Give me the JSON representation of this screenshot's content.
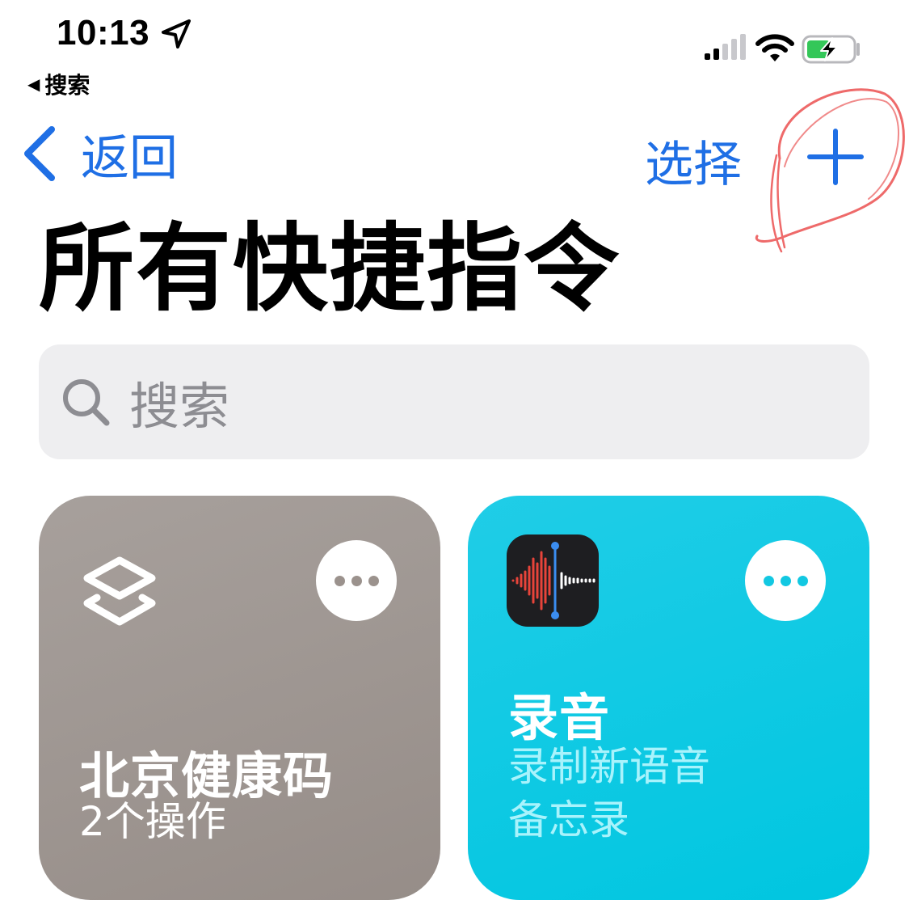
{
  "status_bar": {
    "time": "10:13",
    "back_app_label": "搜索",
    "icons": [
      "location-arrow-icon",
      "cellular-signal-icon",
      "wifi-icon",
      "battery-charging-icon"
    ]
  },
  "nav": {
    "back_label": "返回",
    "select_label": "选择",
    "add_icon": "plus-icon",
    "accent_color": "#1f6fe5"
  },
  "page": {
    "title": "所有快捷指令"
  },
  "search": {
    "placeholder": "搜索",
    "icon": "search-icon"
  },
  "shortcuts": [
    {
      "title": "北京健康码",
      "subtitle": "2个操作",
      "icon": "shortcuts-layers-icon",
      "color": "#9d9590"
    },
    {
      "title": "录音",
      "subtitle": "录制新语音\n备忘录",
      "icon": "voice-memos-icon",
      "color": "#0fc9e3"
    }
  ],
  "annotation": {
    "color": "#ee6a6a",
    "shape": "hand-drawn-circle"
  }
}
